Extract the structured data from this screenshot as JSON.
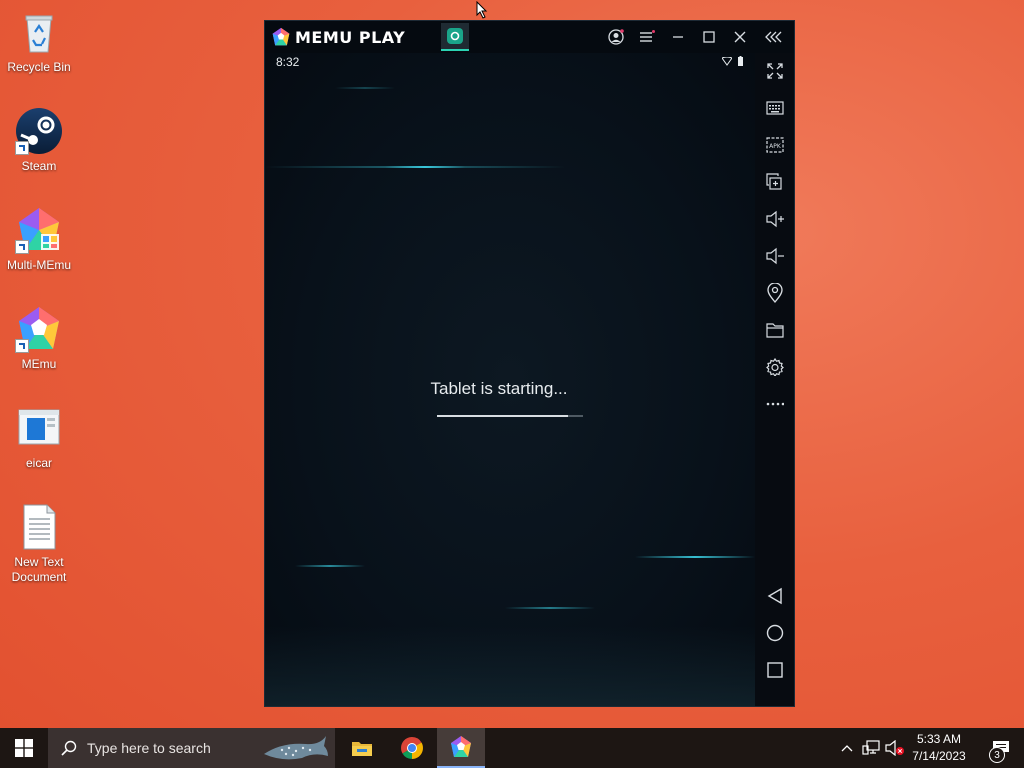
{
  "desktop": {
    "icons": [
      {
        "label": "Recycle Bin",
        "icon": "recycle-bin-icon"
      },
      {
        "label": "Steam",
        "icon": "steam-icon"
      },
      {
        "label": "Multi-MEmu",
        "icon": "multi-memu-icon"
      },
      {
        "label": "MEmu",
        "icon": "memu-icon"
      },
      {
        "label": "eicar",
        "icon": "eicar-file-icon"
      },
      {
        "label": "New Text\nDocument",
        "icon": "text-document-icon"
      }
    ]
  },
  "emulator": {
    "brand": "MEMU PLAY",
    "status_time": "8:32",
    "boot_message": "Tablet is starting...",
    "boot_progress": 0.9,
    "title_controls": [
      "account-icon",
      "menu-icon",
      "minimize-icon",
      "maximize-icon",
      "close-icon",
      "collapse-sidebar-icon"
    ],
    "sidebar_tools": [
      "fullscreen-icon",
      "keyboard-icon",
      "apk-install-icon",
      "multi-window-icon",
      "volume-up-icon",
      "volume-down-icon",
      "location-icon",
      "folder-icon",
      "settings-icon",
      "more-icon"
    ],
    "nav_buttons": [
      "back-icon",
      "home-icon",
      "recents-icon"
    ]
  },
  "taskbar": {
    "search_placeholder": "Type here to search",
    "time": "5:33 AM",
    "date": "7/14/2023",
    "notification_count": "3",
    "accent": "#8ab4f8"
  }
}
